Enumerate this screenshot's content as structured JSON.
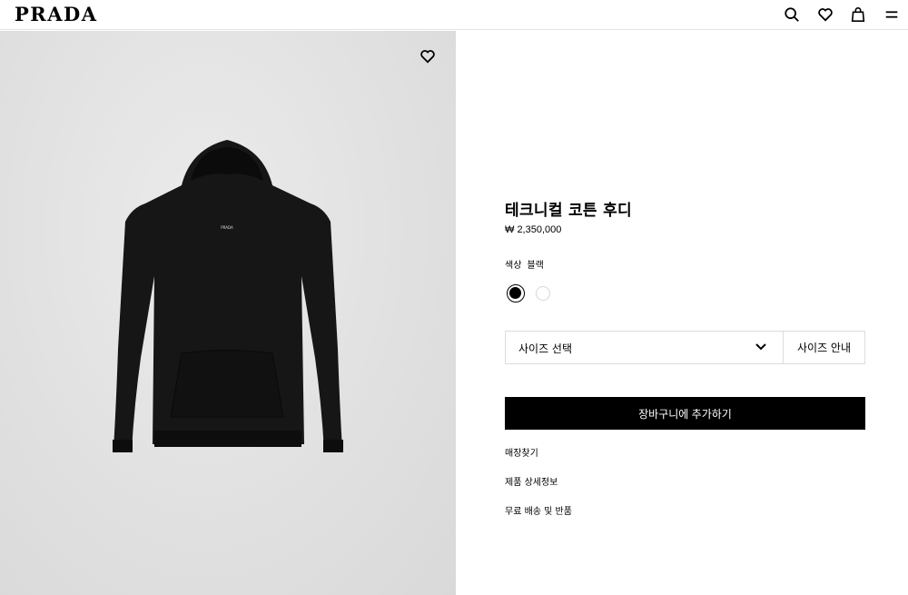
{
  "header": {
    "logo": "PRADA",
    "icons": [
      "search-icon",
      "heart-icon",
      "shopping-bag-icon",
      "menu-icon"
    ]
  },
  "product": {
    "title": "테크니컬 코튼 후디",
    "price": "₩ 2,350,000",
    "color_label": "색상",
    "color_value": "블랙",
    "swatches": [
      {
        "name": "black",
        "color": "#000000",
        "selected": true
      },
      {
        "name": "white",
        "color": "#ffffff",
        "selected": false
      }
    ],
    "size_select_label": "사이즈 선택",
    "size_guide_label": "사이즈 안내",
    "add_to_cart_label": "장바구니에 추가하기",
    "links": {
      "store_finder": "매장찾기",
      "product_details": "제품 상세정보",
      "shipping_returns": "무료 배송 및 반품"
    },
    "image_logo_text": "PRADA"
  },
  "colors": {
    "accent": "#000000",
    "image_bg": "#e0e0e0",
    "border": "#dcdcdc"
  }
}
